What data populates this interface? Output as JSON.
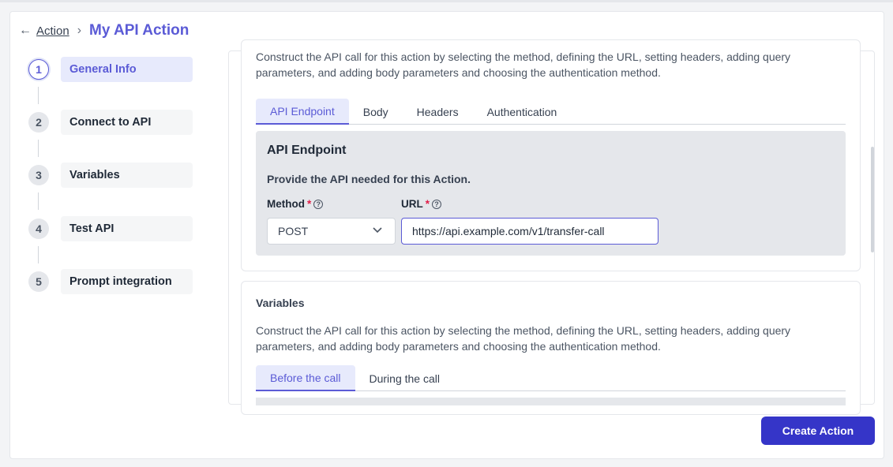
{
  "breadcrumb": {
    "back_icon": "←",
    "parent": "Action",
    "separator": "›",
    "title": "My API Action"
  },
  "steps": [
    {
      "number": "1",
      "label": "General Info",
      "active": true
    },
    {
      "number": "2",
      "label": "Connect to API",
      "active": false
    },
    {
      "number": "3",
      "label": "Variables",
      "active": false
    },
    {
      "number": "4",
      "label": "Test API",
      "active": false
    },
    {
      "number": "5",
      "label": "Prompt integration",
      "active": false
    }
  ],
  "api_section": {
    "description": "Construct the API call for this action by selecting the method, defining the URL, setting headers, adding query parameters, and adding body parameters and choosing the authentication method.",
    "tabs": [
      "API Endpoint",
      "Body",
      "Headers",
      "Authentication"
    ],
    "active_tab": "API Endpoint",
    "endpoint": {
      "title": "API Endpoint",
      "subtitle": "Provide the API needed for this Action.",
      "method_label": "Method",
      "url_label": "URL",
      "required_mark": "*",
      "help_icon": "?",
      "method_value": "POST",
      "url_value": "https://api.example.com/v1/transfer-call"
    }
  },
  "variables_section": {
    "title": "Variables",
    "description": "Construct the API call for this action by selecting the method, defining the URL, setting headers, adding query parameters, and adding body parameters and choosing the authentication method.",
    "tabs": [
      "Before the call",
      "During the call"
    ],
    "active_tab": "Before the call"
  },
  "footer": {
    "create_label": "Create Action"
  },
  "colors": {
    "accent": "#5b5bd6",
    "primary_button": "#3535c8",
    "required": "#e11d48"
  }
}
